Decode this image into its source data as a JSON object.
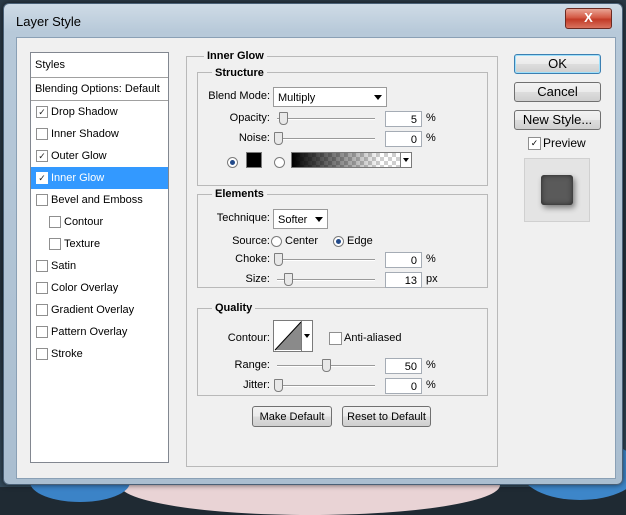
{
  "window": {
    "title": "Layer Style",
    "close_glyph": "X"
  },
  "styles_list": {
    "header": "Styles",
    "blending_options": "Blending Options: Default",
    "items": [
      {
        "label": "Drop Shadow",
        "checked": true,
        "selected": false,
        "sub": false
      },
      {
        "label": "Inner Shadow",
        "checked": false,
        "selected": false,
        "sub": false
      },
      {
        "label": "Outer Glow",
        "checked": true,
        "selected": false,
        "sub": false
      },
      {
        "label": "Inner Glow",
        "checked": true,
        "selected": true,
        "sub": false
      },
      {
        "label": "Bevel and Emboss",
        "checked": false,
        "selected": false,
        "sub": false
      },
      {
        "label": "Contour",
        "checked": false,
        "selected": false,
        "sub": true
      },
      {
        "label": "Texture",
        "checked": false,
        "selected": false,
        "sub": true
      },
      {
        "label": "Satin",
        "checked": false,
        "selected": false,
        "sub": false
      },
      {
        "label": "Color Overlay",
        "checked": false,
        "selected": false,
        "sub": false
      },
      {
        "label": "Gradient Overlay",
        "checked": false,
        "selected": false,
        "sub": false
      },
      {
        "label": "Pattern Overlay",
        "checked": false,
        "selected": false,
        "sub": false
      },
      {
        "label": "Stroke",
        "checked": false,
        "selected": false,
        "sub": false
      }
    ]
  },
  "inner_glow": {
    "title": "Inner Glow",
    "structure": {
      "title": "Structure",
      "blend_mode_label": "Blend Mode:",
      "blend_mode_value": "Multiply",
      "opacity_label": "Opacity:",
      "opacity_value": "5",
      "opacity_unit": "%",
      "noise_label": "Noise:",
      "noise_value": "0",
      "noise_unit": "%",
      "glow_color": "#000000"
    },
    "elements": {
      "title": "Elements",
      "technique_label": "Technique:",
      "technique_value": "Softer",
      "source_label": "Source:",
      "source_center": "Center",
      "source_edge": "Edge",
      "choke_label": "Choke:",
      "choke_value": "0",
      "choke_unit": "%",
      "size_label": "Size:",
      "size_value": "13",
      "size_unit": "px"
    },
    "quality": {
      "title": "Quality",
      "contour_label": "Contour:",
      "anti_aliased_label": "Anti-aliased",
      "range_label": "Range:",
      "range_value": "50",
      "range_unit": "%",
      "jitter_label": "Jitter:",
      "jitter_value": "0",
      "jitter_unit": "%"
    },
    "make_default": "Make Default",
    "reset_to_default": "Reset to Default"
  },
  "actions": {
    "ok": "OK",
    "cancel": "Cancel",
    "new_style": "New Style...",
    "preview_label": "Preview",
    "preview_checked": true
  }
}
